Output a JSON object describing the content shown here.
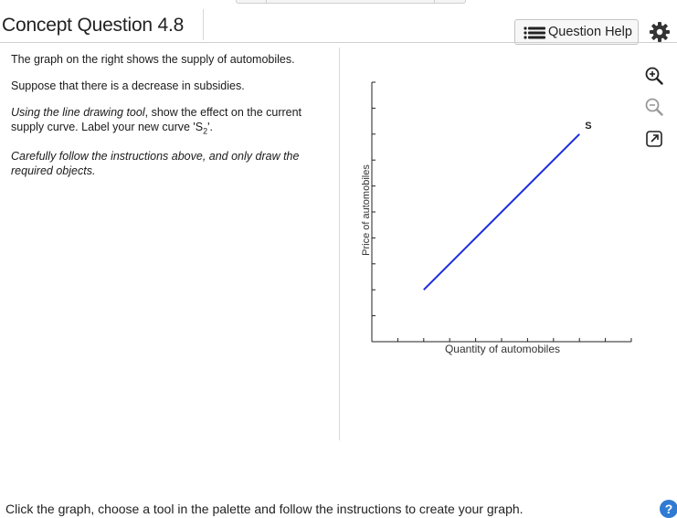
{
  "header": {
    "title": "Concept Question 4.8",
    "question_help_label": "Question Help"
  },
  "instructions": {
    "p1": "The graph on the right shows the supply of automobiles.",
    "p2": "Suppose that there is a decrease in subsidies.",
    "p3_italic": "Using the line drawing tool",
    "p3_rest_before_sub": ", show the effect on the current supply curve. Label your new curve 'S",
    "p3_sub": "2",
    "p3_end": "'.",
    "p4": "Carefully follow the instructions above, and only draw the required objects."
  },
  "graph_tools": {
    "zoom_in_icon": "zoom-in-icon",
    "zoom_out_icon": "zoom-out-icon",
    "popout_icon": "popout-icon"
  },
  "chart_data": {
    "type": "line",
    "title": "",
    "xlabel": "Quantity of automobiles",
    "ylabel": "Price of automobiles",
    "x_ticks": 10,
    "y_ticks": 10,
    "xlim": [
      0,
      10
    ],
    "ylim": [
      0,
      10
    ],
    "grid": false,
    "series": [
      {
        "name": "S",
        "color": "#1a2be0",
        "x": [
          2,
          8
        ],
        "y": [
          2,
          8
        ]
      }
    ]
  },
  "footer": {
    "instruction": "Click the graph, choose a tool in the palette and follow the instructions to create your graph.",
    "help_symbol": "?"
  },
  "colors": {
    "supply_line": "#1a2be0",
    "help_blue": "#2f7bd3"
  }
}
